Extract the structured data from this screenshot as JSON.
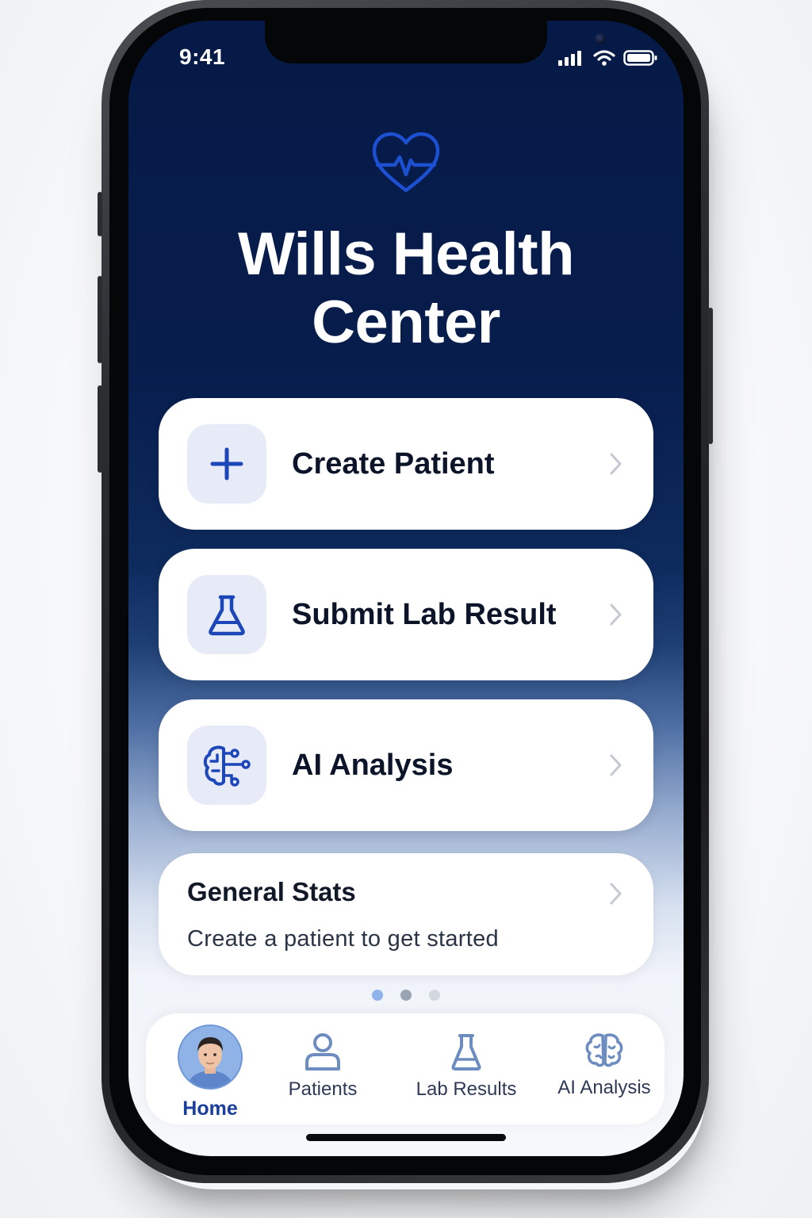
{
  "status_bar": {
    "time": "9:41",
    "icons": [
      "signal-icon",
      "wifi-icon",
      "battery-icon"
    ]
  },
  "header": {
    "logo_icon": "heart-pulse-icon",
    "title_line1": "Wills Health",
    "title_line2": "Center"
  },
  "actions": [
    {
      "label": "Create Patient",
      "icon": "plus-icon"
    },
    {
      "label": "Submit Lab Result",
      "icon": "flask-icon"
    },
    {
      "label": "AI Analysis",
      "icon": "brain-circuit-icon"
    }
  ],
  "stats": {
    "title": "General Stats",
    "subtitle": "Create a patient to get started"
  },
  "pagination": {
    "count": 3,
    "active_index": 0
  },
  "tab_bar": {
    "items": [
      {
        "label": "Home",
        "icon": "avatar",
        "active": true
      },
      {
        "label": "Patients",
        "icon": "person-icon",
        "active": false
      },
      {
        "label": "Lab Results",
        "icon": "flask-icon",
        "active": false
      },
      {
        "label": "AI Analysis",
        "icon": "brain-icon",
        "active": false
      }
    ]
  },
  "colors": {
    "background_top": "#061a47",
    "accent": "#1a3e9e",
    "icon_box": "#e7ebf7",
    "card": "#ffffff"
  }
}
